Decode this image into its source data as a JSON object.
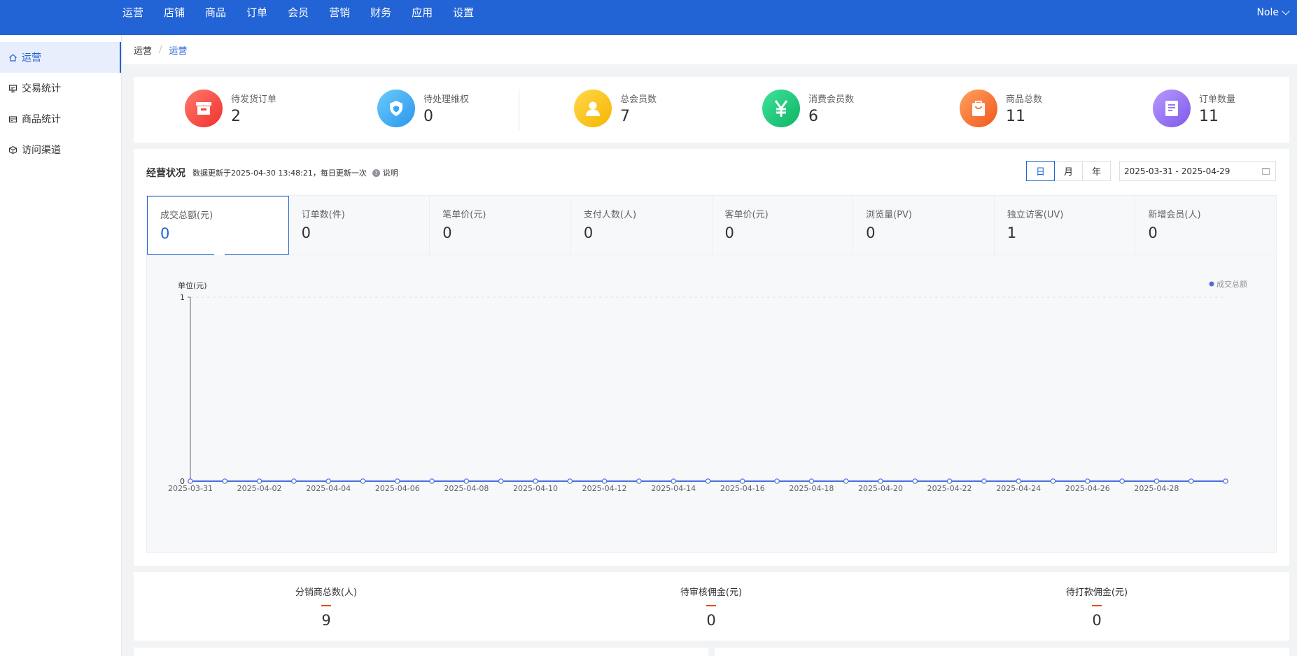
{
  "topnav": {
    "items": [
      "运营",
      "店铺",
      "商品",
      "订单",
      "会员",
      "营销",
      "财务",
      "应用",
      "设置"
    ],
    "user_name": "Nole"
  },
  "sidebar": {
    "items": [
      {
        "label": "运营",
        "icon": "home-icon"
      },
      {
        "label": "交易统计",
        "icon": "monitor-icon"
      },
      {
        "label": "商品统计",
        "icon": "card-icon"
      },
      {
        "label": "访问渠道",
        "icon": "channel-icon"
      }
    ]
  },
  "breadcrumb": [
    "运营",
    "运营"
  ],
  "stats": [
    {
      "label": "待发货订单",
      "value": "2",
      "color": "#f5433d",
      "icon": "shipping-box-icon"
    },
    {
      "label": "待处理维权",
      "value": "0",
      "color": "#35a8f5",
      "icon": "shield-icon"
    },
    {
      "label": "总会员数",
      "value": "7",
      "color": "#fbc52b",
      "icon": "user-icon"
    },
    {
      "label": "消费会员数",
      "value": "6",
      "color": "#19c37a",
      "icon": "yen-icon"
    },
    {
      "label": "商品总数",
      "value": "11",
      "color": "#fa7a2c",
      "icon": "bag-icon"
    },
    {
      "label": "订单数量",
      "value": "11",
      "color": "#9a77f3",
      "icon": "document-icon"
    }
  ],
  "business": {
    "title": "经营状况",
    "note": "数据更新于2025-04-30 13:48:21，每日更新一次",
    "explain_label": "说明",
    "periods": [
      "日",
      "月",
      "年"
    ],
    "date_range": "2025-03-31 - 2025-04-29",
    "metrics": [
      {
        "label": "成交总额(元)",
        "value": "0"
      },
      {
        "label": "订单数(件)",
        "value": "0"
      },
      {
        "label": "笔单价(元)",
        "value": "0"
      },
      {
        "label": "支付人数(人)",
        "value": "0"
      },
      {
        "label": "客单价(元)",
        "value": "0"
      },
      {
        "label": "浏览量(PV)",
        "value": "0"
      },
      {
        "label": "独立访客(UV)",
        "value": "1"
      },
      {
        "label": "新增会员(人)",
        "value": "0"
      }
    ]
  },
  "chart_data": {
    "type": "line",
    "ylabel": "单位(元)",
    "ylim": [
      0,
      1
    ],
    "yticks": [
      "0",
      "1"
    ],
    "series": [
      {
        "name": "成交总额",
        "values": [
          0,
          0,
          0,
          0,
          0,
          0,
          0,
          0,
          0,
          0,
          0,
          0,
          0,
          0,
          0,
          0,
          0,
          0,
          0,
          0,
          0,
          0,
          0,
          0,
          0,
          0,
          0,
          0,
          0,
          0,
          0
        ]
      }
    ],
    "x": [
      "2025-03-31",
      "2025-04-01",
      "2025-04-02",
      "2025-04-03",
      "2025-04-04",
      "2025-04-05",
      "2025-04-06",
      "2025-04-07",
      "2025-04-08",
      "2025-04-09",
      "2025-04-10",
      "2025-04-11",
      "2025-04-12",
      "2025-04-13",
      "2025-04-14",
      "2025-04-15",
      "2025-04-16",
      "2025-04-17",
      "2025-04-18",
      "2025-04-19",
      "2025-04-20",
      "2025-04-21",
      "2025-04-22",
      "2025-04-23",
      "2025-04-24",
      "2025-04-25",
      "2025-04-26",
      "2025-04-27",
      "2025-04-28",
      "2025-04-29",
      "2025-04-30"
    ],
    "xtick_labels": [
      "2025-03-31",
      "2025-04-02",
      "2025-04-04",
      "2025-04-06",
      "2025-04-08",
      "2025-04-10",
      "2025-04-12",
      "2025-04-14",
      "2025-04-16",
      "2025-04-18",
      "2025-04-20",
      "2025-04-22",
      "2025-04-24",
      "2025-04-26",
      "2025-04-28"
    ],
    "line_color": "#4a6ee0",
    "legend_position": "top-right",
    "grid": true
  },
  "distribution": [
    {
      "label": "分销商总数(人)",
      "value": "9"
    },
    {
      "label": "待审核佣金(元)",
      "value": "0"
    },
    {
      "label": "待打款佣金(元)",
      "value": "0"
    }
  ]
}
